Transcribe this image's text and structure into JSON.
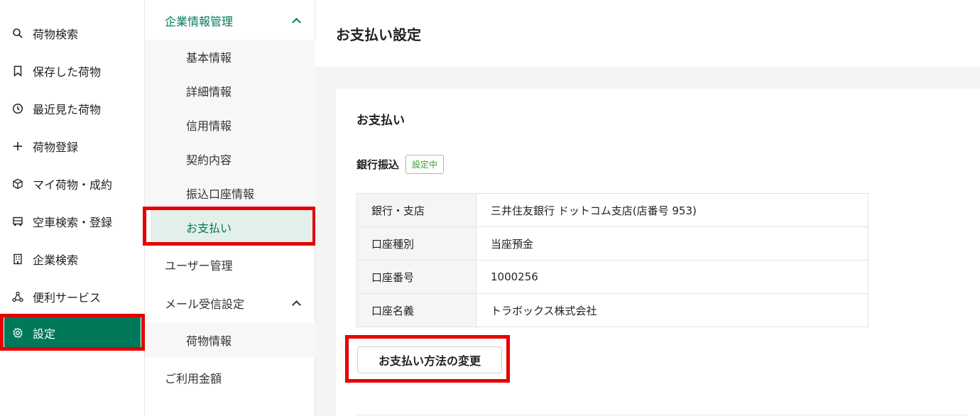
{
  "nav": {
    "items": [
      {
        "label": "荷物検索",
        "icon": "search-icon"
      },
      {
        "label": "保存した荷物",
        "icon": "bookmark-icon"
      },
      {
        "label": "最近見た荷物",
        "icon": "clock-icon"
      },
      {
        "label": "荷物登録",
        "icon": "plus-icon"
      },
      {
        "label": "マイ荷物・成約",
        "icon": "box-icon"
      },
      {
        "label": "空車検索・登録",
        "icon": "truck-icon"
      },
      {
        "label": "企業検索",
        "icon": "building-icon"
      },
      {
        "label": "便利サービス",
        "icon": "network-icon"
      },
      {
        "label": "設定",
        "icon": "gear-icon"
      }
    ],
    "active_color": "#00785a"
  },
  "subnav": {
    "company_group": "企業情報管理",
    "company_items": [
      "基本情報",
      "詳細情報",
      "信用情報",
      "契約内容",
      "振込口座情報",
      "お支払い"
    ],
    "user_management": "ユーザー管理",
    "mail_group": "メール受信設定",
    "mail_items": [
      "荷物情報"
    ],
    "usage_fee": "ご利用金額"
  },
  "main": {
    "page_title": "お支払い設定",
    "card_title": "お支払い",
    "method_label": "銀行振込",
    "status_badge": "設定中",
    "rows": [
      {
        "key": "銀行・支店",
        "value": "三井住友銀行 ドットコム支店(店番号 953)"
      },
      {
        "key": "口座種別",
        "value": "当座預金"
      },
      {
        "key": "口座番号",
        "value": "1000256"
      },
      {
        "key": "口座名義",
        "value": "トラボックス株式会社"
      }
    ],
    "change_button": "お支払い方法の変更"
  }
}
